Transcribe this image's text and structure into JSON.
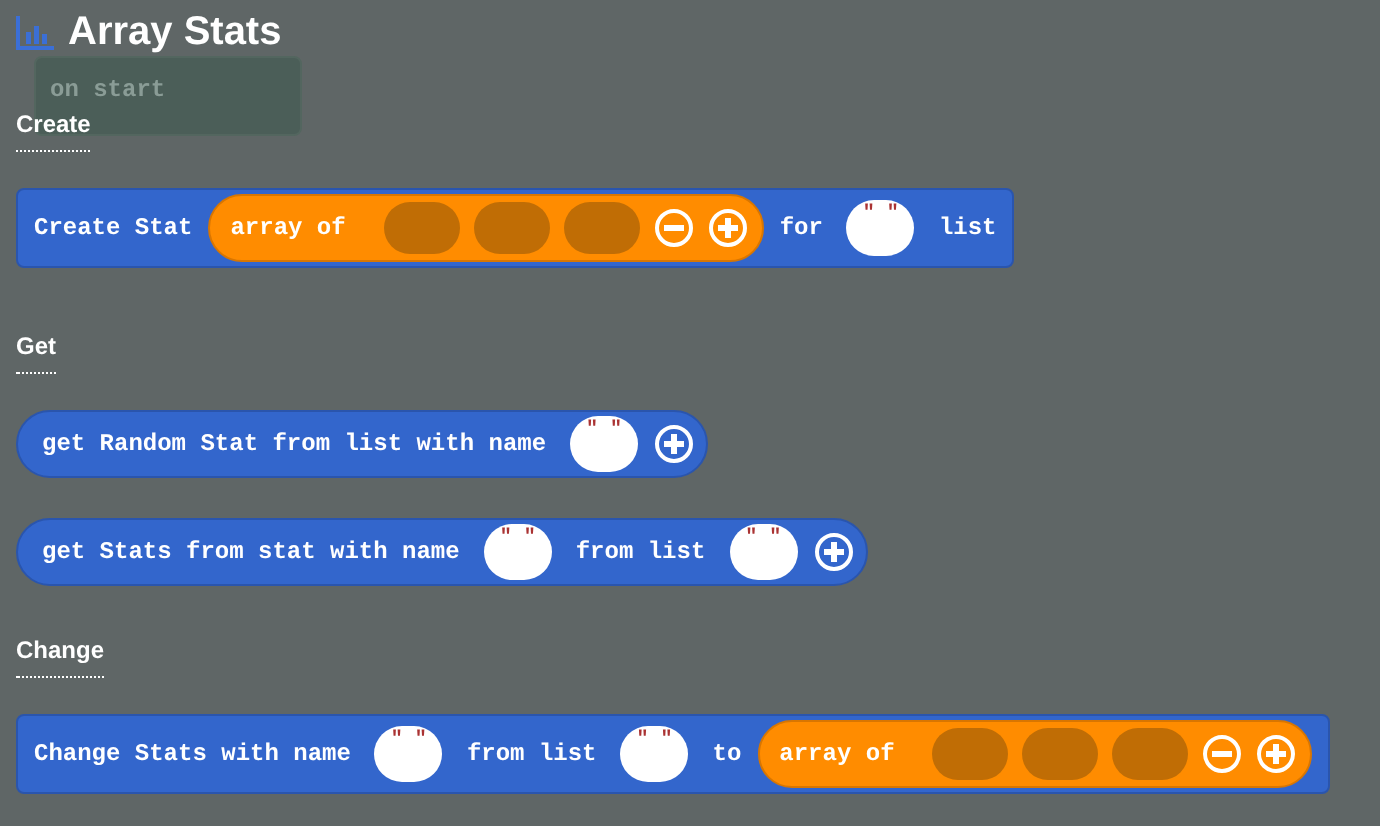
{
  "title": "Array Stats",
  "ghost_block": {
    "label": "on start"
  },
  "sections": [
    {
      "heading": "Create",
      "blocks": [
        {
          "kind": "statement",
          "parts": [
            {
              "kind": "label",
              "text": "Create Stat"
            },
            {
              "kind": "array",
              "text": "array of",
              "slots": [
                {
                  "kind": "empty"
                },
                {
                  "kind": "empty"
                },
                {
                  "kind": "empty"
                }
              ]
            },
            {
              "kind": "minus"
            },
            {
              "kind": "plus"
            },
            {
              "kind": "label",
              "text": "for"
            },
            {
              "kind": "string",
              "text": "\" \""
            },
            {
              "kind": "label",
              "text": "list"
            }
          ]
        }
      ]
    },
    {
      "heading": "Get",
      "blocks": [
        {
          "kind": "reporter",
          "parts": [
            {
              "kind": "label",
              "text": "get Random Stat from list with name"
            },
            {
              "kind": "string",
              "text": "\" \""
            },
            {
              "kind": "plus"
            }
          ]
        },
        {
          "kind": "reporter",
          "parts": [
            {
              "kind": "label",
              "text": "get Stats from stat with name"
            },
            {
              "kind": "string",
              "text": "\" \""
            },
            {
              "kind": "label",
              "text": "from list"
            },
            {
              "kind": "string",
              "text": "\" \""
            },
            {
              "kind": "plus"
            }
          ]
        }
      ]
    },
    {
      "heading": "Change",
      "blocks": [
        {
          "kind": "statement",
          "parts": [
            {
              "kind": "label",
              "text": "Change Stats with name"
            },
            {
              "kind": "string",
              "text": "\" \""
            },
            {
              "kind": "label",
              "text": "from list"
            },
            {
              "kind": "string",
              "text": "\" \""
            },
            {
              "kind": "label",
              "text": "to"
            },
            {
              "kind": "array",
              "text": "array of",
              "slots": [
                {
                  "kind": "empty"
                },
                {
                  "kind": "empty"
                },
                {
                  "kind": "empty"
                }
              ]
            },
            {
              "kind": "minus"
            },
            {
              "kind": "plus"
            }
          ]
        }
      ]
    }
  ]
}
